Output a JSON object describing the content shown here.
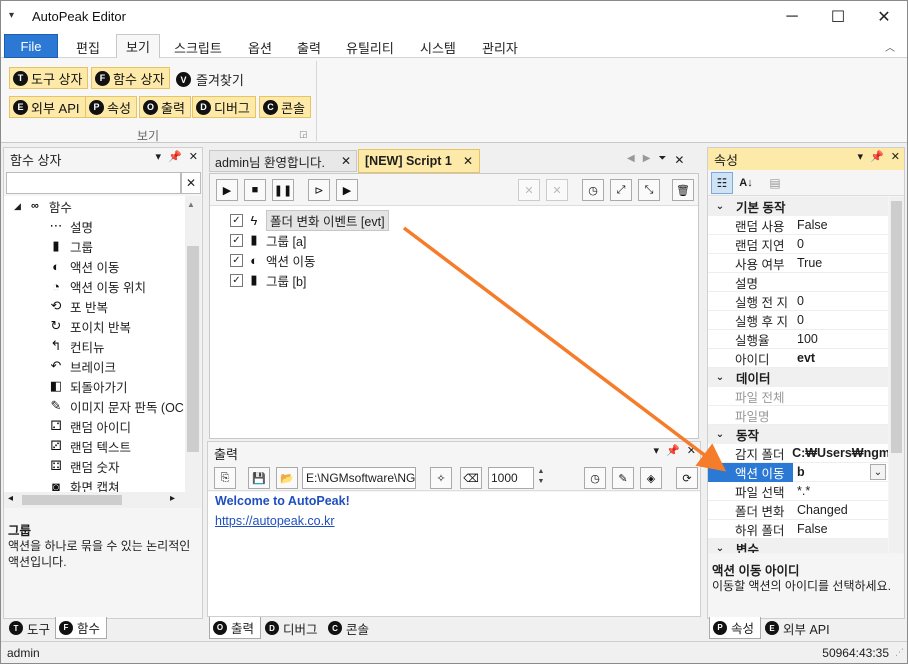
{
  "window": {
    "title": "AutoPeak Editor",
    "minimize": "─",
    "maximize": "☐",
    "close": "✕",
    "app_icon": "▾"
  },
  "menu": {
    "file": "File",
    "tabs": [
      "편집",
      "보기",
      "스크립트",
      "옵션",
      "출력",
      "유틸리티",
      "시스템",
      "관리자"
    ],
    "active_index": 1,
    "collapse_icon": "︿"
  },
  "ribbon": {
    "row1": [
      {
        "badge": "T",
        "label": "도구 상자"
      },
      {
        "badge": "F",
        "label": "함수 상자"
      }
    ],
    "favorites": {
      "badge": "V",
      "label": "즐겨찾기"
    },
    "row2": [
      {
        "badge": "E",
        "label": "외부 API"
      },
      {
        "badge": "P",
        "label": "속성"
      },
      {
        "badge": "O",
        "label": "출력"
      },
      {
        "badge": "D",
        "label": "디버그"
      },
      {
        "badge": "C",
        "label": "콘솔"
      }
    ],
    "group_label": "보기"
  },
  "function_box": {
    "title": "함수 상자",
    "search_value": "",
    "root": "함수",
    "items": [
      {
        "icon": "⋯",
        "label": "설명"
      },
      {
        "icon": "▮",
        "label": "그룹"
      },
      {
        "icon": "◐",
        "label": "액션 이동"
      },
      {
        "icon": "◔",
        "label": "액션 이동 위치"
      },
      {
        "icon": "⟲",
        "label": "포 반복"
      },
      {
        "icon": "↻",
        "label": "포이치 반복"
      },
      {
        "icon": "↰",
        "label": "컨티뉴"
      },
      {
        "icon": "↶",
        "label": "브레이크"
      },
      {
        "icon": "◧",
        "label": "되돌아가기"
      },
      {
        "icon": "✎",
        "label": "이미지 문자 판독 (OC"
      },
      {
        "icon": "⚁",
        "label": "랜덤 아이디"
      },
      {
        "icon": "⚂",
        "label": "랜덤 텍스트"
      },
      {
        "icon": "⚃",
        "label": "랜덤 숫자"
      },
      {
        "icon": "◙",
        "label": "화면 캡쳐"
      }
    ],
    "desc_title": "그룹",
    "desc_text": "액션을 하나로 묶을 수 있는 논리적인 액션입니다.",
    "bottom_tabs": [
      {
        "badge": "T",
        "label": "도구"
      },
      {
        "badge": "F",
        "label": "함수"
      }
    ]
  },
  "editor": {
    "tabs": [
      {
        "label": "admin님 환영합니다.",
        "close": "✕"
      },
      {
        "label": "[NEW] Script 1",
        "close": "✕"
      }
    ],
    "tree": [
      {
        "checked": true,
        "icon": "ϟ",
        "label": "폴더 변화 이벤트 [evt]",
        "indent": 0
      },
      {
        "checked": true,
        "icon": "▮",
        "label": "그룹 [a]",
        "indent": 0
      },
      {
        "checked": true,
        "icon": "◐",
        "label": "액션 이동",
        "indent": 0
      },
      {
        "checked": true,
        "icon": "▮",
        "label": "그룹 [b]",
        "indent": 0
      }
    ]
  },
  "output": {
    "title": "출력",
    "path_value": "E:\\NGMsoftware\\NG",
    "number_value": "1000",
    "welcome": "Welcome to AutoPeak!",
    "link": "https://autopeak.co.kr",
    "bottom_tabs": [
      {
        "badge": "O",
        "label": "출력"
      },
      {
        "badge": "D",
        "label": "디버그"
      },
      {
        "badge": "C",
        "label": "콘솔"
      }
    ]
  },
  "properties": {
    "title": "속성",
    "categories": [
      {
        "name": "기본 동작",
        "rows": [
          [
            "랜덤 사용",
            "False"
          ],
          [
            "랜덤 지연",
            "0"
          ],
          [
            "사용 여부",
            "True"
          ],
          [
            "설명",
            ""
          ],
          [
            "실행 전 지",
            "0"
          ],
          [
            "실행 후 지",
            "0"
          ],
          [
            "실행율",
            "100"
          ],
          [
            "아이디",
            "evt"
          ]
        ]
      },
      {
        "name": "데이터",
        "rows": [
          [
            "파일 전체",
            ""
          ],
          [
            "파일명",
            ""
          ]
        ]
      },
      {
        "name": "동작",
        "rows": [
          [
            "감지 폴더",
            "C:₩Users₩ngma"
          ],
          [
            "액션 이동",
            "b"
          ],
          [
            "파일 선택",
            "*.*"
          ],
          [
            "폴더 변화",
            "Changed"
          ],
          [
            "하위 폴더",
            "False"
          ]
        ]
      },
      {
        "name": "변수",
        "rows": []
      }
    ],
    "desc_title": "액션 이동 아이디",
    "desc_text": "이동할 액션의 아이디를 선택하세요.",
    "bottom_tabs": [
      {
        "badge": "P",
        "label": "속성"
      },
      {
        "badge": "E",
        "label": "외부 API"
      }
    ]
  },
  "status": {
    "user": "admin",
    "time": "50964:43:35"
  },
  "colors": {
    "accent": "#2b79d4",
    "ribbon_btn": "#fde9a8",
    "arrow": "#f57c2a",
    "link": "#1f4fbf"
  }
}
